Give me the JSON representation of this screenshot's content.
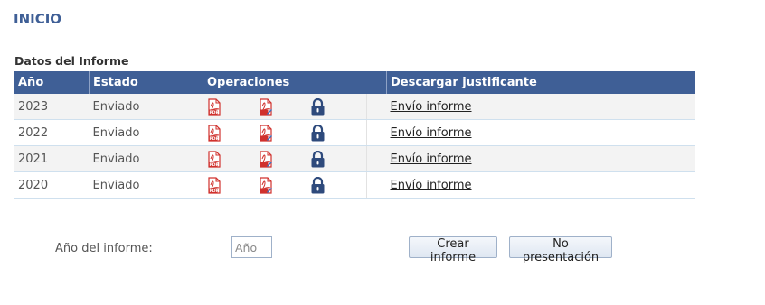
{
  "page": {
    "title": "INICIO"
  },
  "report": {
    "section_title": "Datos del Informe",
    "headers": {
      "year": "Año",
      "status": "Estado",
      "operations": "Operaciones",
      "download": "Descargar justificante"
    },
    "rows": [
      {
        "year": "2023",
        "status": "Enviado",
        "link": "Envío informe"
      },
      {
        "year": "2022",
        "status": "Enviado",
        "link": "Envío informe"
      },
      {
        "year": "2021",
        "status": "Enviado",
        "link": "Envío informe"
      },
      {
        "year": "2020",
        "status": "Enviado",
        "link": "Envío informe"
      }
    ],
    "icons": [
      "pdf-icon",
      "pdf-edit-icon",
      "lock-icon"
    ]
  },
  "form": {
    "year_label": "Año del informe:",
    "year_placeholder": "Año",
    "create_button": "Crear informe",
    "no_presentation_button": "No presentación"
  },
  "colors": {
    "header_bg": "#3f5f96",
    "title": "#3f5f96",
    "pdf_red": "#d0312d",
    "lock": "#2e4a7c"
  }
}
